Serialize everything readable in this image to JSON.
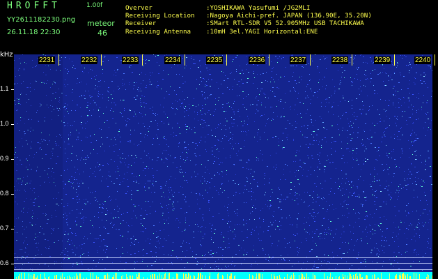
{
  "header": {
    "logo": "HROFFT",
    "version": "1.00f",
    "filename": "YY2611182230.png",
    "timestamp": "26.11.18 22:30",
    "meteor_label": "meteor",
    "meteor_count": "46"
  },
  "station_info": [
    {
      "label": "Overver",
      "value": ":YOSHIKAWA Yasufumi /JG2MLI"
    },
    {
      "label": "Receiving Location",
      "value": ":Nagoya Aichi-pref. JAPAN (136.90E, 35.20N)"
    },
    {
      "label": "Receiver",
      "value": ":SMart RTL-SDR V5 52.905MHz USB TACHIKAWA"
    },
    {
      "label": "Receiving Antenna",
      "value": ":10mH 3el.YAGI Horizontal:ENE"
    }
  ],
  "plot": {
    "y_unit": "kHz",
    "y_ticks": [
      "1.1",
      "1.0",
      "0.9",
      "0.8",
      "0.7",
      "0.6"
    ],
    "y_values": [
      1.1,
      1.0,
      0.9,
      0.8,
      0.7,
      0.6
    ],
    "x_ticks": [
      "2231",
      "2232",
      "2233",
      "2234",
      "2235",
      "2236",
      "2237",
      "2238",
      "2239",
      "2240"
    ],
    "colors": {
      "background": "#14248e",
      "noise_bright": "#5fffd6",
      "noise_mid": "#3a55ff",
      "baseline": "#00ffff",
      "tick": "#ffff4d",
      "header_green": "#7dff7d"
    }
  }
}
